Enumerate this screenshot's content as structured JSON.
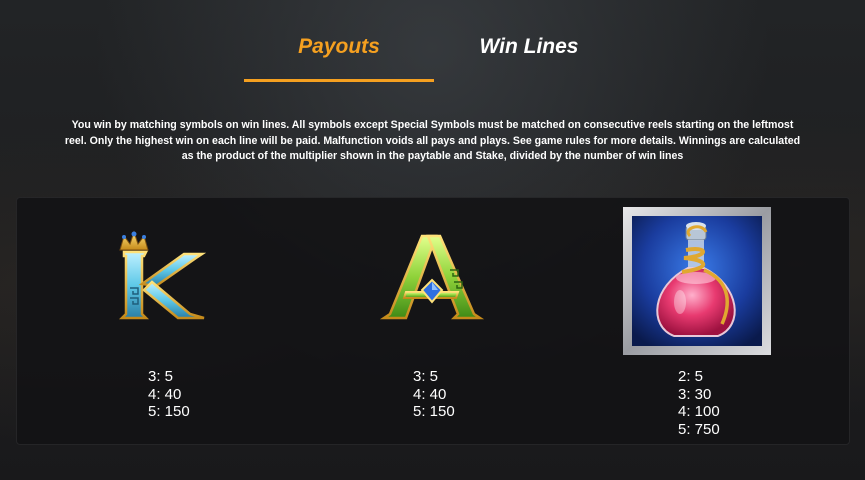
{
  "tabs": {
    "payouts_label": "Payouts",
    "winlines_label": "Win Lines",
    "active": "Payouts"
  },
  "rules_text": "You win by matching symbols on win lines. All symbols except Special Symbols must be matched on consecutive reels starting on the leftmost reel. Only the highest win on each line will be paid. Malfunction voids all pays and plays. See game rules for more details. Winnings are calculated as the product of the multiplier shown in the paytable and Stake, divided by the number of win lines",
  "symbols": [
    {
      "icon": "letter-k-crown-icon",
      "letter": "K",
      "payouts": [
        "3: 5",
        "4: 40",
        "5: 150"
      ]
    },
    {
      "icon": "letter-a-gem-icon",
      "letter": "A",
      "payouts": [
        "3: 5",
        "4: 40",
        "5: 150"
      ]
    },
    {
      "icon": "potion-bottle-icon",
      "payouts": [
        "2: 5",
        "3: 30",
        "4: 100",
        "5: 750"
      ]
    }
  ],
  "colors": {
    "accent": "#f5a020",
    "k_letter": "#5fc9e8",
    "a_letter": "#8fd23a",
    "potion_liquid": "#e83a70"
  }
}
